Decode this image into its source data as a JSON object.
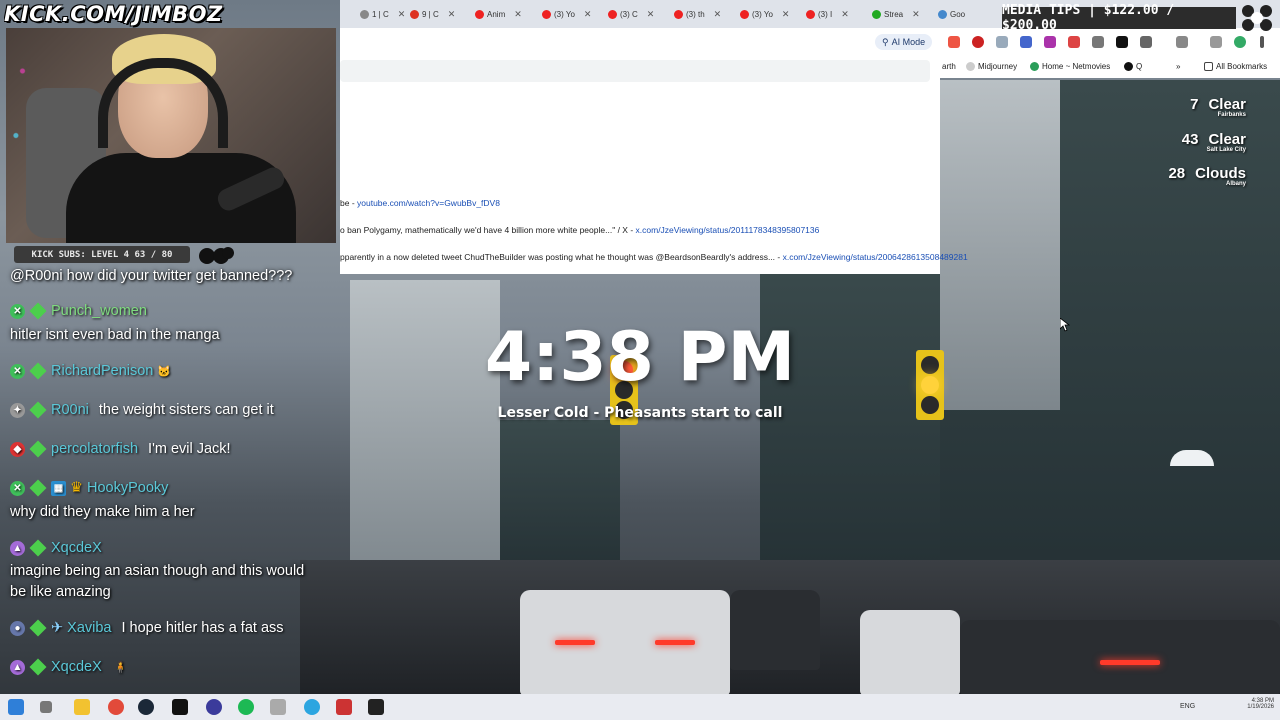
{
  "overlay": {
    "channel_banner": "KICK.COM/JIMBOZ",
    "subs_goal": "KICK SUBS: LEVEL 4 63 / 80",
    "media_tips": "MEDIA TIPS | $122.00 / $200.00"
  },
  "weather": [
    {
      "temp": "7",
      "condition": "Clear",
      "city": "Fairbanks"
    },
    {
      "temp": "43",
      "condition": "Clear",
      "city": "Salt Lake City"
    },
    {
      "temp": "28",
      "condition": "Clouds",
      "city": "Albany"
    }
  ],
  "clock": {
    "time": "4:38 PM",
    "subtitle": "Lesser Cold - Pheasants start to call"
  },
  "browser": {
    "tabs": [
      {
        "label": "1 | C"
      },
      {
        "label": "9 | C"
      },
      {
        "label": "Anim"
      },
      {
        "label": "(3) Yo"
      },
      {
        "label": "(3) C"
      },
      {
        "label": "(3) th"
      },
      {
        "label": "(3) Yo"
      },
      {
        "label": "(3) I"
      },
      {
        "label": "Strea"
      },
      {
        "label": "Goo"
      }
    ],
    "ai_mode": "AI Mode",
    "bookmarks": [
      {
        "label": "arth"
      },
      {
        "label": "Midjourney"
      },
      {
        "label": "Home ~ Netmovies"
      },
      {
        "label": "Q"
      },
      {
        "label": "All Bookmarks"
      }
    ],
    "results": [
      {
        "text": "be - ",
        "link": "youtube.com/watch?v=GwubBv_fDV8"
      },
      {
        "text": "o ban Polygamy, mathematically we'd have 4 billion more white people...\" / X - ",
        "link": "x.com/JzeViewing/status/2011178348395807136"
      },
      {
        "text": "pparently in a now deleted tweet ChudTheBuilder was posting what he thought was @BeardsonBeardly's address... - ",
        "link": "x.com/JzeViewing/status/2006428613508489281"
      }
    ]
  },
  "chat": {
    "top_message": "@R00ni how did your twitter get banned???",
    "messages": [
      {
        "user": "Punch_women",
        "color": "#7fdb7f",
        "text": "hitler isnt even bad in the manga",
        "inline": false
      },
      {
        "user": "RichardPenison",
        "color": "#5bc8d8",
        "text": "",
        "inline": true
      },
      {
        "user": "R00ni",
        "color": "#5bc8d8",
        "text": "the weight sisters can get it",
        "inline": true
      },
      {
        "user": "percolatorfish",
        "color": "#5bc8d8",
        "text": "I'm evil Jack!",
        "inline": true
      },
      {
        "user": "HookyPooky",
        "color": "#5bc8d8",
        "text": "why did they make him a her",
        "inline": false
      },
      {
        "user": "XqcdeX",
        "color": "#5bc8d8",
        "text": "imagine being an asian though and this would",
        "text2": "be like amazing",
        "inline": false
      },
      {
        "user": "Xaviba",
        "color": "#5bc8d8",
        "text": "I hope hitler has a fat ass",
        "inline": true
      },
      {
        "user": "XqcdeX",
        "color": "#5bc8d8",
        "text": "",
        "inline": true
      }
    ]
  },
  "taskbar": {
    "lang": "ENG",
    "time": "4:38 PM",
    "date": "1/19/2026"
  }
}
